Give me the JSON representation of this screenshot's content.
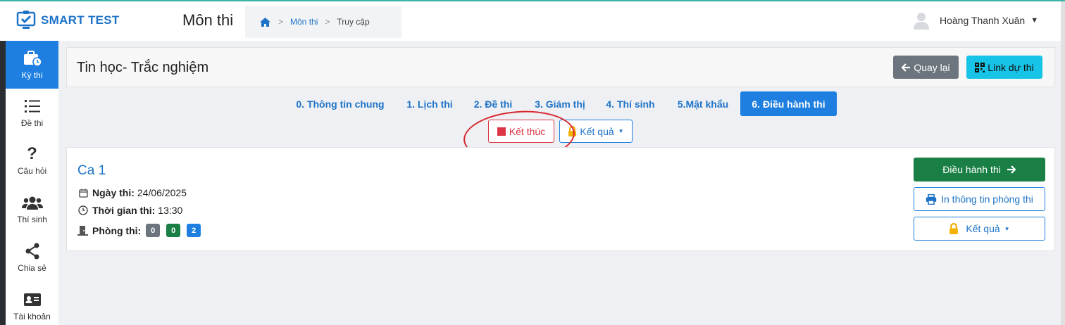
{
  "app": {
    "name": "SMART TEST"
  },
  "header": {
    "title": "Môn thi",
    "breadcrumb": {
      "link": "Môn thi",
      "current": "Truy cập"
    },
    "user": "Hoàng Thanh Xuân"
  },
  "sidebar": {
    "items": [
      {
        "label": "Kỳ thi",
        "icon": "briefcase-clock-icon",
        "active": true
      },
      {
        "label": "Đề thi",
        "icon": "list-icon"
      },
      {
        "label": "Câu hỏi",
        "icon": "question-icon"
      },
      {
        "label": "Thí sinh",
        "icon": "users-icon"
      },
      {
        "label": "Chia sẻ",
        "icon": "share-icon"
      },
      {
        "label": "Tài khoản",
        "icon": "id-card-icon"
      }
    ]
  },
  "exam": {
    "title": "Tin học- Trắc nghiệm",
    "back_label": "Quay lại",
    "link_label": "Link dự thi"
  },
  "tabs": [
    {
      "label": "0. Thông tin chung"
    },
    {
      "label": "1. Lịch thi"
    },
    {
      "label": "2. Đề thi"
    },
    {
      "label": "3. Giám thị"
    },
    {
      "label": "4. Thí sinh"
    },
    {
      "label": "5.Mật khẩu"
    },
    {
      "label": "6. Điều hành thi",
      "active": true
    }
  ],
  "actions": {
    "end_label": "Kết thúc",
    "result_label": "Kết quả"
  },
  "session": {
    "name": "Ca 1",
    "date_label": "Ngày thi:",
    "date": "24/06/2025",
    "time_label": "Thời gian thi:",
    "time": "13:30",
    "rooms_label": "Phòng thi:",
    "room_counts": [
      "0",
      "0",
      "2"
    ],
    "operate_label": "Điều hành thi",
    "print_label": "In thông tin phòng thi",
    "result_label": "Kết quả"
  },
  "colors": {
    "primary": "#1e7fe0",
    "success": "#1a7f45",
    "danger": "#dc3545",
    "secondary": "#6c757d",
    "info": "#17c3e6"
  }
}
